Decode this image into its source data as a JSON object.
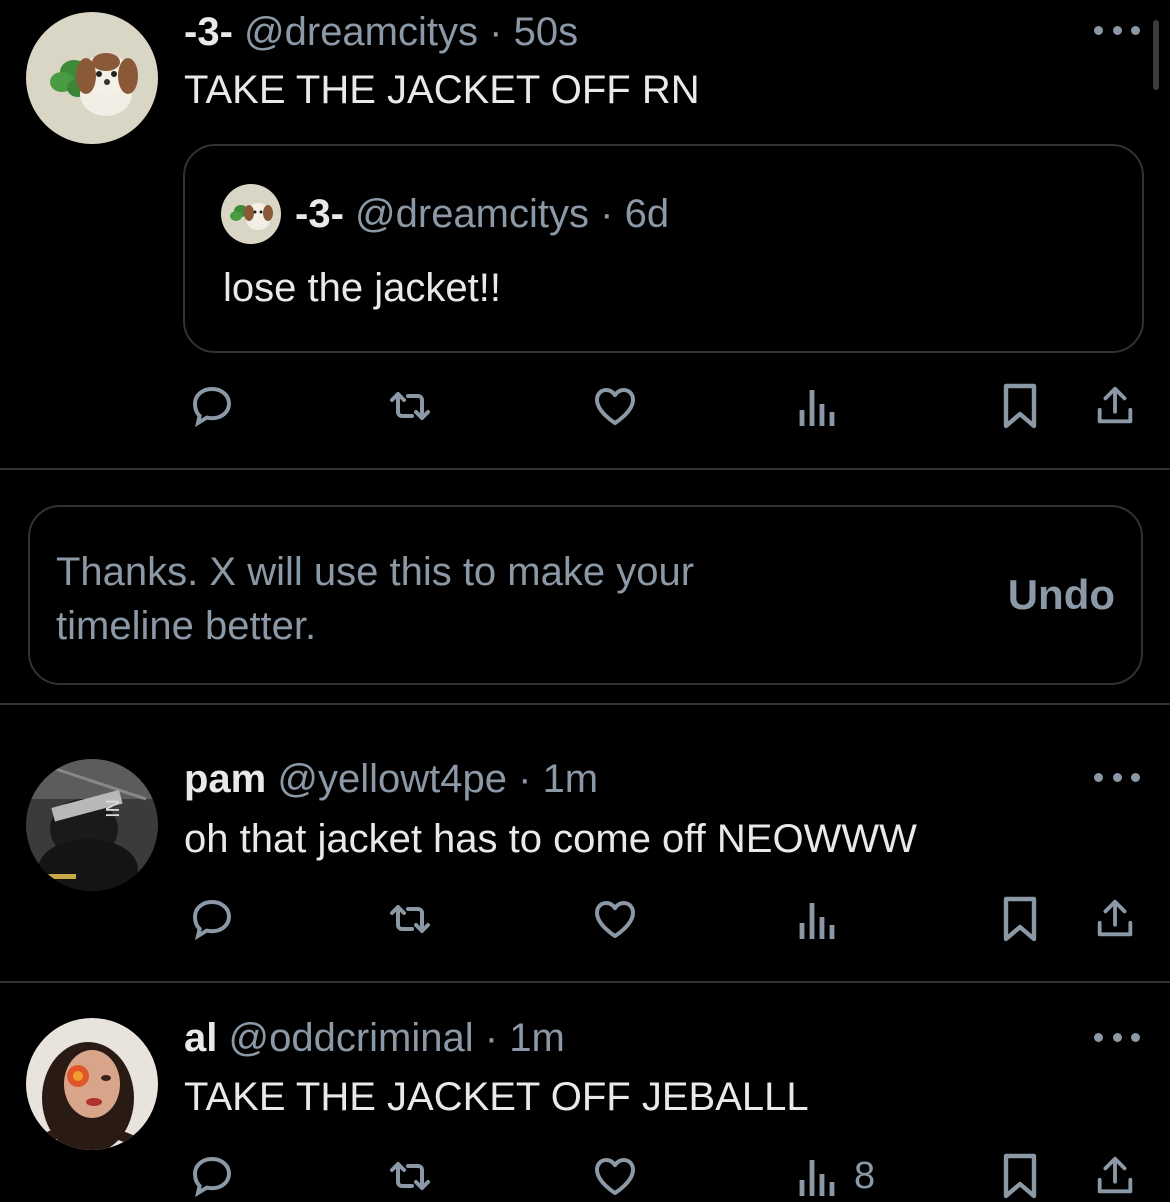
{
  "posts": [
    {
      "name": "-3-",
      "handle": "@dreamcitys",
      "separator": "·",
      "time": "50s",
      "text": "TAKE THE JACKET OFF RN",
      "quote": {
        "name": "-3-",
        "handle": "@dreamcitys",
        "separator": "·",
        "time": "6d",
        "text": "lose the jacket!!"
      },
      "views": ""
    },
    {
      "name": "pam",
      "handle": "@yellowt4pe",
      "separator": "·",
      "time": "1m",
      "text": "oh that jacket has to come off NEOWWW",
      "views": ""
    },
    {
      "name": "al",
      "handle": "@oddcriminal",
      "separator": "·",
      "time": "1m",
      "text": "TAKE THE JACKET OFF JEBALLL",
      "views": "8"
    }
  ],
  "notice": {
    "text": "Thanks. X will use this to make your timeline better.",
    "undo_label": "Undo"
  },
  "icons": {
    "reply": "reply-icon",
    "repost": "repost-icon",
    "like": "heart-icon",
    "views": "views-icon",
    "bookmark": "bookmark-icon",
    "share": "share-icon",
    "more": "more-icon"
  },
  "colors": {
    "background": "#000000",
    "text_primary": "#e7e9ea",
    "text_secondary": "#8b98a5",
    "border": "#2f3336"
  }
}
